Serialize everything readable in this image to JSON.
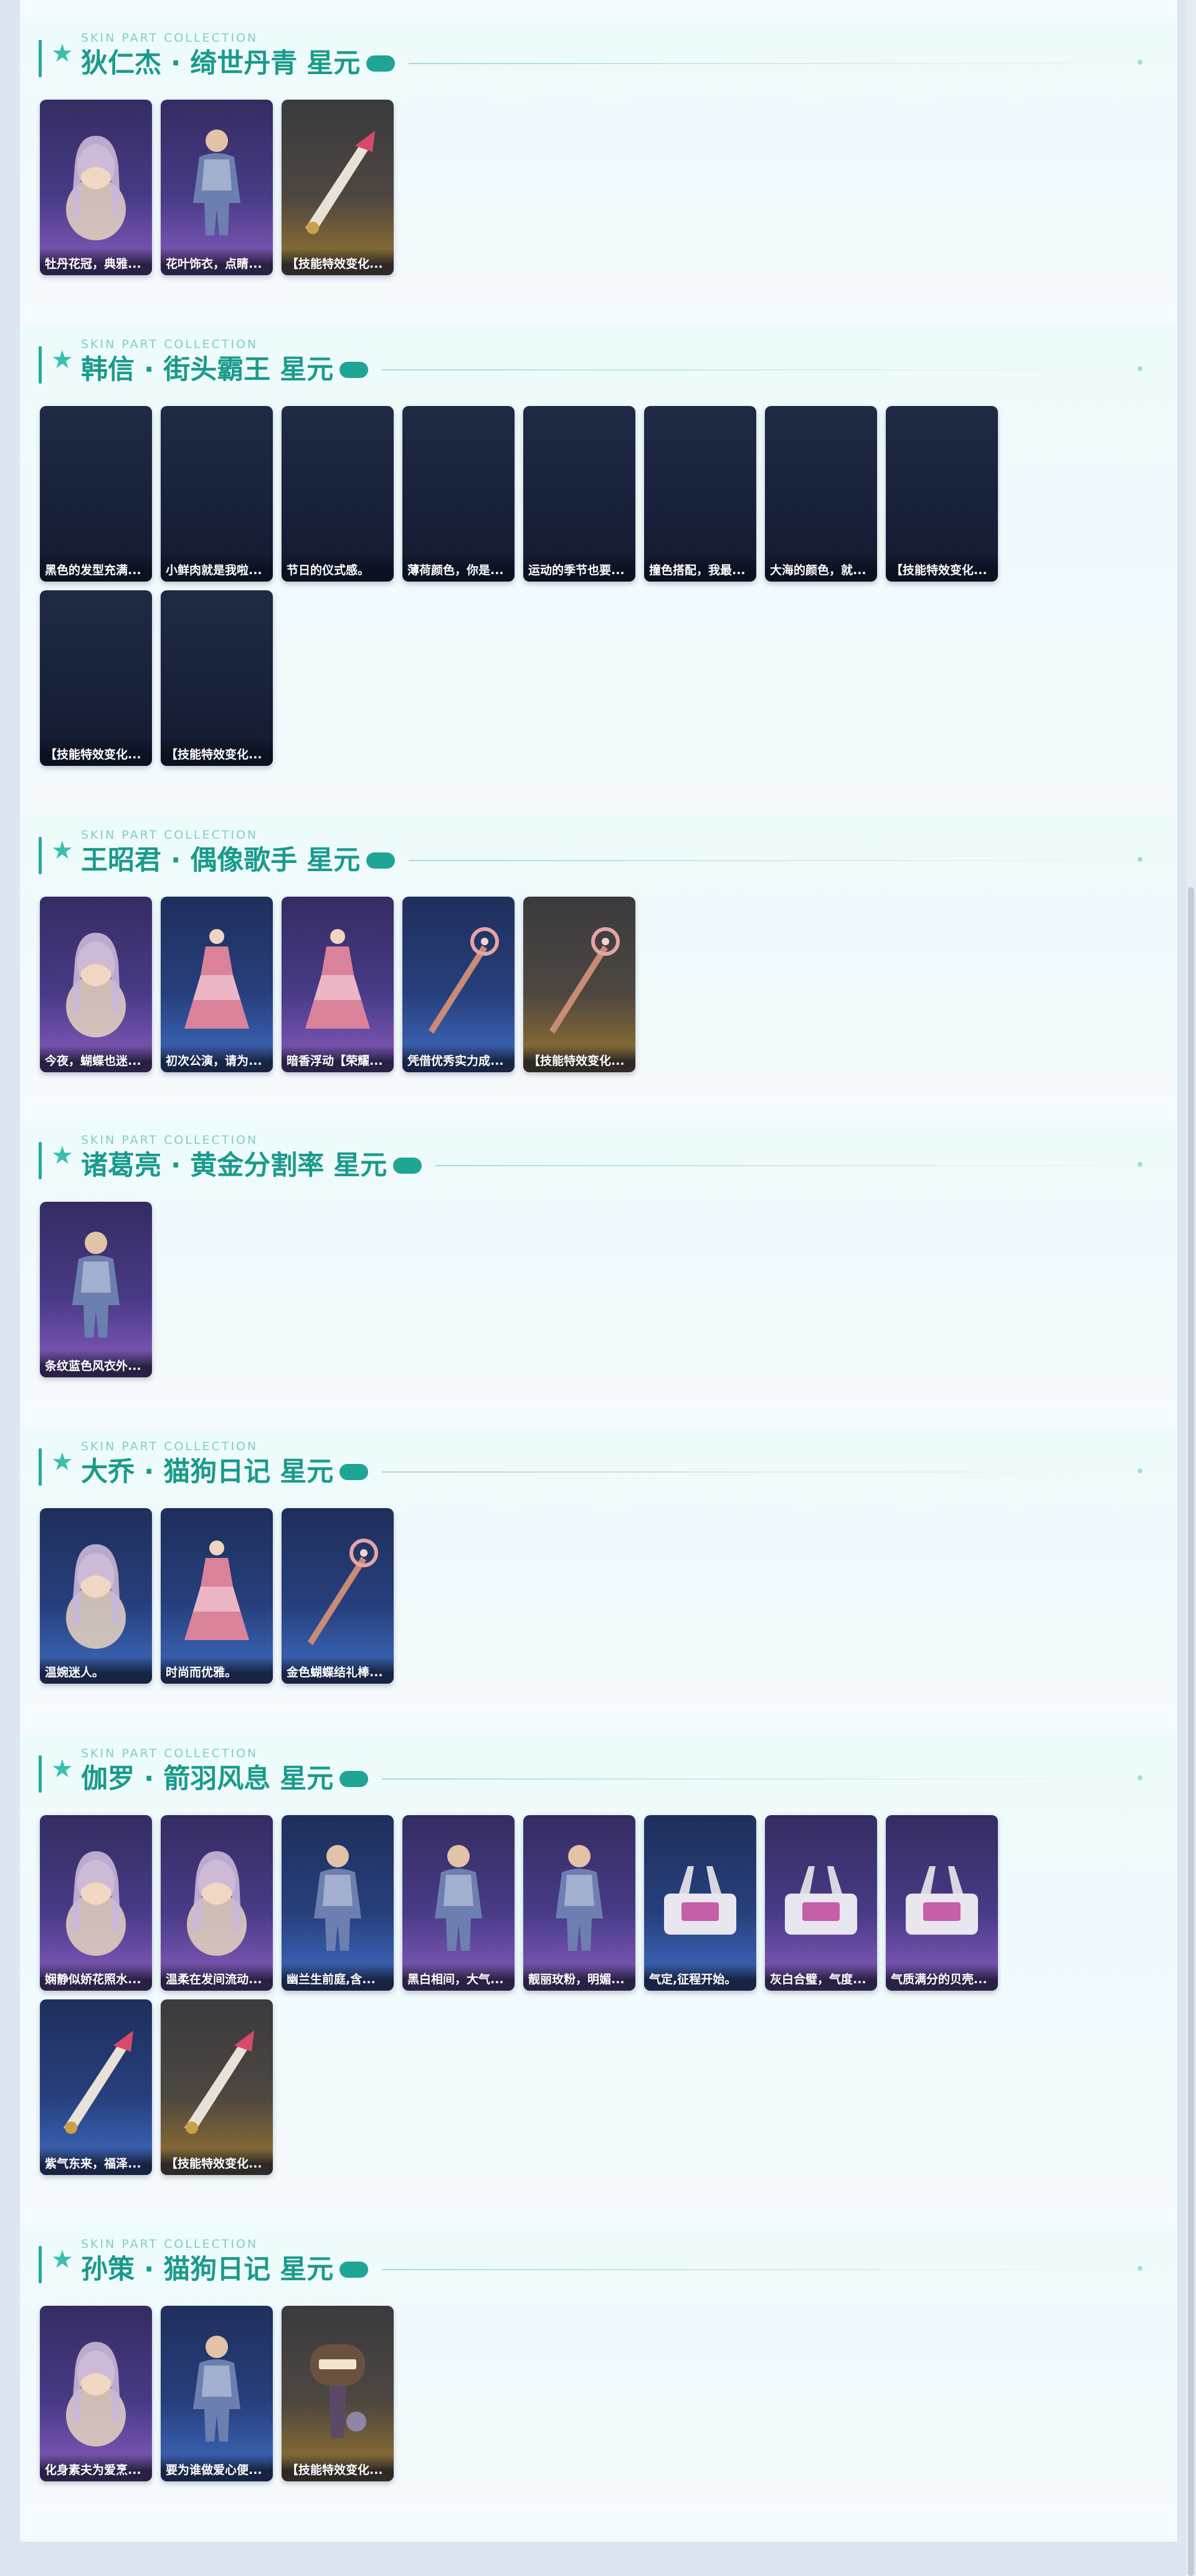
{
  "sections": [
    {
      "subtitle": "SKIN PART COLLECTION",
      "title": "狄仁杰 · 绮世丹青 星元",
      "items": [
        {
          "label": "牡丹花冠，典雅...",
          "theme": "purple",
          "art": "portrait"
        },
        {
          "label": "花叶饰衣，点睛...",
          "theme": "purple",
          "art": "figure"
        },
        {
          "label": "【技能特效变化...",
          "theme": "gold",
          "art": "weapon"
        }
      ]
    },
    {
      "subtitle": "SKIN PART COLLECTION",
      "title": "韩信 · 街头霸王 星元",
      "items": [
        {
          "label": "黑色的发型充满...",
          "theme": "dark",
          "art": "none"
        },
        {
          "label": "小鲜肉就是我啦...",
          "theme": "dark",
          "art": "none"
        },
        {
          "label": "节日的仪式感。",
          "theme": "dark",
          "art": "none"
        },
        {
          "label": "薄荷颜色，你是...",
          "theme": "dark",
          "art": "none"
        },
        {
          "label": "运动的季节也要...",
          "theme": "dark",
          "art": "none"
        },
        {
          "label": "撞色搭配，我最...",
          "theme": "dark",
          "art": "none"
        },
        {
          "label": "大海的颜色，就...",
          "theme": "dark",
          "art": "none"
        },
        {
          "label": "【技能特效变化...",
          "theme": "dark",
          "art": "none"
        },
        {
          "label": "【技能特效变化...",
          "theme": "dark",
          "art": "none"
        },
        {
          "label": "【技能特效变化...",
          "theme": "dark",
          "art": "none"
        }
      ]
    },
    {
      "subtitle": "SKIN PART COLLECTION",
      "title": "王昭君 · 偶像歌手 星元",
      "items": [
        {
          "label": "今夜，蝴蝶也迷...",
          "theme": "purple",
          "art": "portrait"
        },
        {
          "label": "初次公演，请为...",
          "theme": "blue",
          "art": "dress"
        },
        {
          "label": "暗香浮动【荣耀...",
          "theme": "purple",
          "art": "dress"
        },
        {
          "label": "凭借优秀实力成...",
          "theme": "blue",
          "art": "staff"
        },
        {
          "label": "【技能特效变化...",
          "theme": "gold",
          "art": "staff"
        }
      ]
    },
    {
      "subtitle": "SKIN PART COLLECTION",
      "title": "诸葛亮 · 黄金分割率 星元",
      "items": [
        {
          "label": "条纹蓝色风衣外...",
          "theme": "purple",
          "art": "figure"
        }
      ]
    },
    {
      "subtitle": "SKIN PART COLLECTION",
      "title": "大乔 · 猫狗日记 星元",
      "items": [
        {
          "label": "温婉迷人。",
          "theme": "blue",
          "art": "portrait"
        },
        {
          "label": "时尚而优雅。",
          "theme": "blue",
          "art": "dress"
        },
        {
          "label": "金色蝴蝶结礼棒...",
          "theme": "blue",
          "art": "staff"
        }
      ]
    },
    {
      "subtitle": "SKIN PART COLLECTION",
      "title": "伽罗 · 箭羽风息 星元",
      "items": [
        {
          "label": "娴静似娇花照水...",
          "theme": "purple",
          "art": "portrait"
        },
        {
          "label": "温柔在发间流动...",
          "theme": "purple",
          "art": "portrait"
        },
        {
          "label": "幽兰生前庭,含...",
          "theme": "blue",
          "art": "figure"
        },
        {
          "label": "黑白相间，大气...",
          "theme": "purple",
          "art": "figure"
        },
        {
          "label": "靓丽玫粉，明媚...",
          "theme": "purple",
          "art": "figure"
        },
        {
          "label": "气定,征程开始。",
          "theme": "blue",
          "art": "bag"
        },
        {
          "label": "灰白合璧，气度...",
          "theme": "purple",
          "art": "bag"
        },
        {
          "label": "气质满分的贝壳...",
          "theme": "purple",
          "art": "bag"
        },
        {
          "label": "紫气东来，福泽...",
          "theme": "blue",
          "art": "weapon"
        },
        {
          "label": "【技能特效变化...",
          "theme": "gold",
          "art": "weapon"
        }
      ]
    },
    {
      "subtitle": "SKIN PART COLLECTION",
      "title": "孙策 · 猫狗日记 星元",
      "items": [
        {
          "label": "化身素夫为爱烹...",
          "theme": "purple",
          "art": "portrait"
        },
        {
          "label": "要为谁做爱心便...",
          "theme": "blue",
          "art": "figure"
        },
        {
          "label": "【技能特效变化...",
          "theme": "gold",
          "art": "sign"
        }
      ]
    }
  ]
}
